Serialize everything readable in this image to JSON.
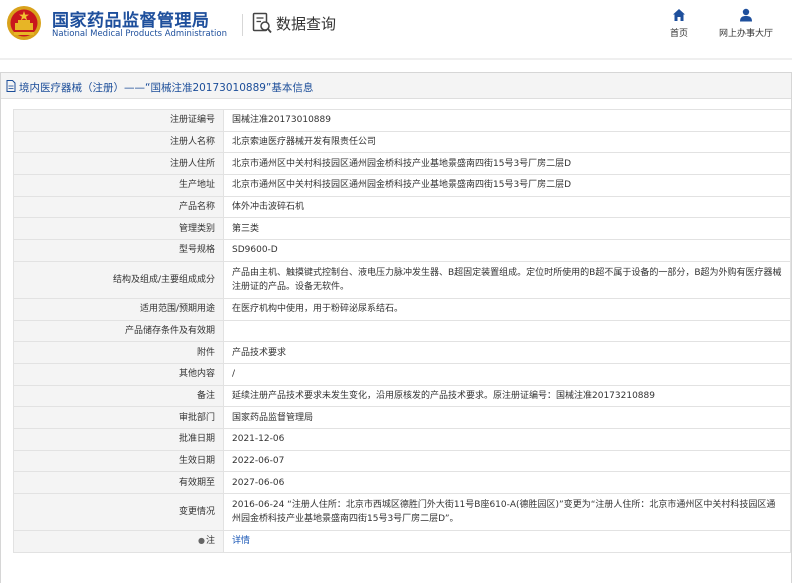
{
  "header": {
    "brand_cn": "国家药品监督管理局",
    "brand_en": "National Medical Products Administration",
    "query_title": "数据查询",
    "nav": {
      "home": "首页",
      "hall": "网上办事大厅"
    }
  },
  "panel": {
    "title": "境内医疗器械（注册）——“国械注准20173010889”基本信息"
  },
  "rows": [
    {
      "label": "注册证编号",
      "value": "国械注准20173010889"
    },
    {
      "label": "注册人名称",
      "value": "北京索迪医疗器械开发有限责任公司"
    },
    {
      "label": "注册人住所",
      "value": "北京市通州区中关村科技园区通州园金桥科技产业基地景盛南四街15号3号厂房二层D"
    },
    {
      "label": "生产地址",
      "value": "北京市通州区中关村科技园区通州园金桥科技产业基地景盛南四街15号3号厂房二层D"
    },
    {
      "label": "产品名称",
      "value": "体外冲击波碎石机"
    },
    {
      "label": "管理类别",
      "value": "第三类"
    },
    {
      "label": "型号规格",
      "value": "SD9600-D"
    },
    {
      "label": "结构及组成/主要组成成分",
      "value": "产品由主机、触摸键式控制台、液电压力脉冲发生器、B超固定装置组成。定位时所使用的B超不属于设备的一部分，B超为外购有医疗器械注册证的产品。设备无软件。"
    },
    {
      "label": "适用范围/预期用途",
      "value": "在医疗机构中使用，用于粉碎泌尿系结石。"
    },
    {
      "label": "产品储存条件及有效期",
      "value": ""
    },
    {
      "label": "附件",
      "value": "产品技术要求"
    },
    {
      "label": "其他内容",
      "value": "/"
    },
    {
      "label": "备注",
      "value": "延续注册产品技术要求未发生变化，沿用原核发的产品技术要求。原注册证编号：国械注准20173210889"
    },
    {
      "label": "审批部门",
      "value": "国家药品监督管理局"
    },
    {
      "label": "批准日期",
      "value": "2021-12-06"
    },
    {
      "label": "生效日期",
      "value": "2022-06-07"
    },
    {
      "label": "有效期至",
      "value": "2027-06-06"
    },
    {
      "label": "变更情况",
      "value": "2016-06-24 “注册人住所：北京市西城区德胜门外大街11号B座610-A(德胜园区)”变更为“注册人住所：北京市通州区中关村科技园区通州园金桥科技产业基地景盛南四街15号3号厂房二层D”。"
    },
    {
      "label": "注",
      "value": "详情"
    }
  ],
  "icons": {
    "emblem": "national-emblem-icon",
    "query": "search-document-icon",
    "home": "home-icon",
    "hall": "user-icon",
    "doc": "document-icon",
    "pin": "pin-icon"
  },
  "colors": {
    "brand": "#1e4f9c",
    "link": "#1a57b6",
    "label_bg": "#f4f4f4"
  }
}
